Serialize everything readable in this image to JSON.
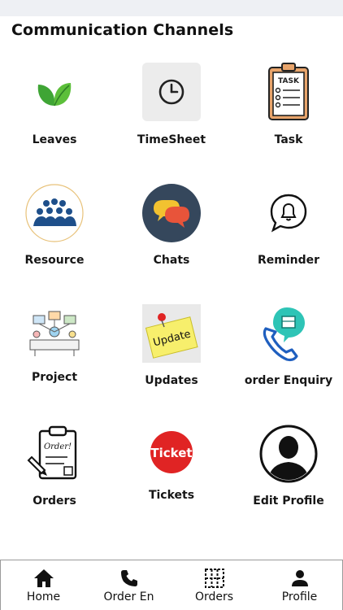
{
  "header": {
    "title": "Communication Channels"
  },
  "tiles": [
    {
      "label": "Leaves",
      "icon": "leaves-icon"
    },
    {
      "label": "TimeSheet",
      "icon": "clock-icon"
    },
    {
      "label": "Task",
      "icon": "task-clipboard-icon"
    },
    {
      "label": "Resource",
      "icon": "people-group-icon"
    },
    {
      "label": "Chats",
      "icon": "chat-bubbles-icon"
    },
    {
      "label": "Reminder",
      "icon": "bell-bubble-icon"
    },
    {
      "label": "Project",
      "icon": "project-network-icon"
    },
    {
      "label": "Updates",
      "icon": "update-note-icon"
    },
    {
      "label": "order Enquiry",
      "icon": "phone-box-icon"
    },
    {
      "label": "Orders",
      "icon": "order-clipboard-icon"
    },
    {
      "label": "Tickets",
      "icon": "ticket-icon"
    },
    {
      "label": "Edit Profile",
      "icon": "profile-avatar-icon"
    }
  ],
  "icon_text": {
    "task": "TASK",
    "update": "Update",
    "order": "Order!",
    "ticket": "Ticket"
  },
  "nav": [
    {
      "label": "Home",
      "icon": "home-icon"
    },
    {
      "label": "Order En",
      "icon": "phone-icon"
    },
    {
      "label": "Orders",
      "icon": "grid-icon"
    },
    {
      "label": "Profile",
      "icon": "person-icon"
    }
  ],
  "colors": {
    "status_bar": "#eef0f4",
    "leaf_green": "#3fa535",
    "chat_bg": "#35475c",
    "task_orange": "#e8a46b",
    "resource_blue": "#1e4f8a",
    "ticket_red": "#e02424",
    "phone_blue": "#1f5fbf",
    "box_teal": "#2ec4b6"
  }
}
